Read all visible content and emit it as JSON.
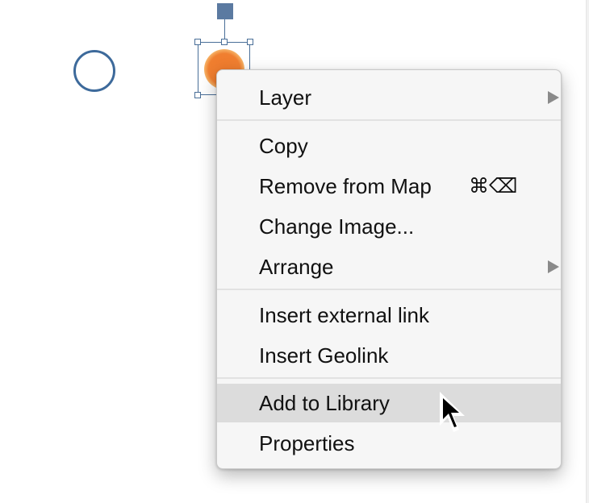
{
  "menu": {
    "items": [
      {
        "label": "Layer",
        "shortcut": "",
        "submenu": true,
        "highlighted": false
      },
      {
        "label": "Copy",
        "shortcut": "",
        "submenu": false,
        "highlighted": false
      },
      {
        "label": "Remove from Map",
        "shortcut": "⌘⌫",
        "submenu": false,
        "highlighted": false
      },
      {
        "label": "Change Image...",
        "shortcut": "",
        "submenu": false,
        "highlighted": false
      },
      {
        "label": "Arrange",
        "shortcut": "",
        "submenu": true,
        "highlighted": false
      },
      {
        "label": "Insert external link",
        "shortcut": "",
        "submenu": false,
        "highlighted": false
      },
      {
        "label": "Insert Geolink",
        "shortcut": "",
        "submenu": false,
        "highlighted": false
      },
      {
        "label": "Add to Library",
        "shortcut": "",
        "submenu": false,
        "highlighted": true
      },
      {
        "label": "Properties",
        "shortcut": "",
        "submenu": false,
        "highlighted": false
      }
    ]
  },
  "colors": {
    "menu_background": "#f6f6f6",
    "menu_highlight": "#dcdcdc",
    "selection": "#4a6f98",
    "circle_outline": "#3d6a9b",
    "marker_orange": "#ef7b2d",
    "submenu_arrow": "#8a8a8a"
  },
  "icons": {
    "rotate_handle": "rotate-handle-icon",
    "submenu": "triangle-right-icon",
    "cursor": "arrow-pointer-icon"
  }
}
